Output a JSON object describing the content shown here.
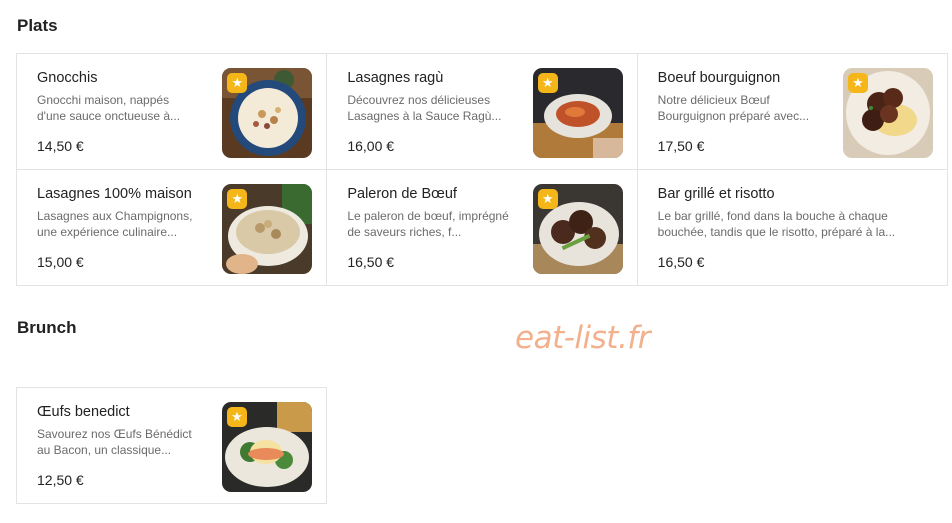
{
  "sections": [
    {
      "title": "Plats",
      "items": [
        {
          "name": "Gnocchis",
          "desc1": "Gnocchi maison, nappés",
          "desc2": "d'une sauce onctueuse à...",
          "price": "14,50 €",
          "image": "gnocchi-bowl-image"
        },
        {
          "name": "Lasagnes ragù",
          "desc1": "Découvrez nos délicieuses",
          "desc2": "Lasagnes à la Sauce Ragù...",
          "price": "16,00 €",
          "image": "lasagne-ragu-image"
        },
        {
          "name": "Boeuf bourguignon",
          "desc1": "Notre délicieux Bœuf",
          "desc2": "Bourguignon préparé avec...",
          "price": "17,50 €",
          "image": "beef-stew-image"
        },
        {
          "name": "Lasagnes 100% maison",
          "desc1": "Lasagnes aux Champignons,",
          "desc2": "une expérience culinaire...",
          "price": "15,00 €",
          "image": "mushroom-lasagne-image"
        },
        {
          "name": "Paleron de Bœuf",
          "desc1": "Le paleron de bœuf, imprégné",
          "desc2": "de saveurs riches, f...",
          "price": "16,50 €",
          "image": "beef-paleron-image"
        },
        {
          "name": "Bar grillé et risotto",
          "desc1": "Le bar grillé, fond dans la bouche à chaque",
          "desc2": "bouchée, tandis que le risotto, préparé à la...",
          "price": "16,50 €",
          "image": null
        }
      ]
    },
    {
      "title": "Brunch",
      "items": [
        {
          "name": "Œufs benedict",
          "desc1": "Savourez nos Œufs Bénédict",
          "desc2": "au Bacon, un classique...",
          "price": "12,50 €",
          "image": "eggs-benedict-image"
        }
      ]
    }
  ],
  "badge_icon": "star-icon",
  "watermark": "eat-list.fr",
  "colors": {
    "badge": "#f4b618",
    "watermark": "#f0a37a",
    "border": "#e3e3e3"
  }
}
